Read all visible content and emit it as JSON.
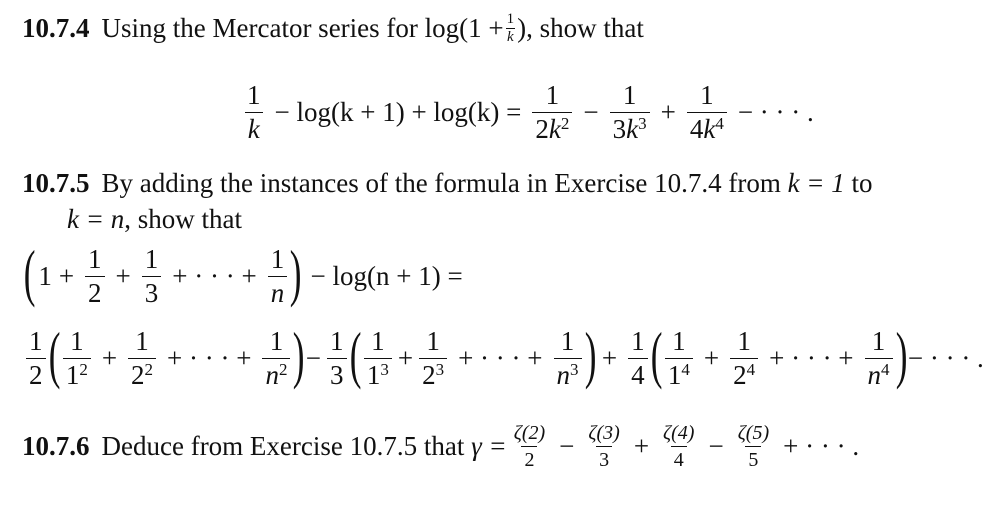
{
  "exercises": [
    {
      "number": "10.7.4",
      "text_before": "Using the Mercator series for log(1 +",
      "inline_frac": {
        "num": "1",
        "den": "k"
      },
      "text_after": "), show that",
      "display_equation": {
        "lhs": {
          "frac": {
            "num": "1",
            "den": "k"
          },
          "rest": "− log(k + 1) + log(k) ="
        },
        "rhs_terms": [
          {
            "sign": "",
            "num": "1",
            "den_coef": "2",
            "den_var": "k",
            "den_exp": "2"
          },
          {
            "sign": "−",
            "num": "1",
            "den_coef": "3",
            "den_var": "k",
            "den_exp": "3"
          },
          {
            "sign": "+",
            "num": "1",
            "den_coef": "4",
            "den_var": "k",
            "den_exp": "4"
          }
        ],
        "tail": "− · · · ."
      }
    },
    {
      "number": "10.7.5",
      "text_line1": "By adding the instances of the formula in Exercise 10.7.4 from",
      "k_eq_1": "k = 1",
      "to": "to",
      "text_line2_var": "k = n",
      "text_line2": ", show that",
      "equation_line1": {
        "one": "1",
        "fracs": [
          {
            "sign": "+",
            "num": "1",
            "den": "2"
          },
          {
            "sign": "+",
            "num": "1",
            "den": "3"
          },
          {
            "sign": "+ · · · +",
            "num": "1",
            "den": "n"
          }
        ],
        "rest": "− log(n + 1) ="
      },
      "equation_line2": {
        "groups": [
          {
            "sign": "",
            "coef_num": "1",
            "coef_den": "2",
            "power": "2",
            "terms": [
              {
                "base": "1"
              },
              {
                "base": "2"
              }
            ],
            "last_base": "n"
          },
          {
            "sign": "−",
            "coef_num": "1",
            "coef_den": "3",
            "power": "3",
            "terms": [
              {
                "base": "1"
              },
              {
                "base": "2"
              }
            ],
            "last_base": "n"
          },
          {
            "sign": "+",
            "coef_num": "1",
            "coef_den": "4",
            "power": "4",
            "terms": [
              {
                "base": "1"
              },
              {
                "base": "2"
              }
            ],
            "last_base": "n"
          }
        ],
        "dots": "+ · · · +",
        "tail": "− · · · ."
      }
    },
    {
      "number": "10.7.6",
      "text": "Deduce from Exercise 10.7.5 that",
      "gamma": "γ =",
      "zeta_terms": [
        {
          "sign": "",
          "num": "ζ(2)",
          "den": "2"
        },
        {
          "sign": "−",
          "num": "ζ(3)",
          "den": "3"
        },
        {
          "sign": "+",
          "num": "ζ(4)",
          "den": "4"
        },
        {
          "sign": "−",
          "num": "ζ(5)",
          "den": "5"
        }
      ],
      "tail": "+ · · · ."
    }
  ]
}
